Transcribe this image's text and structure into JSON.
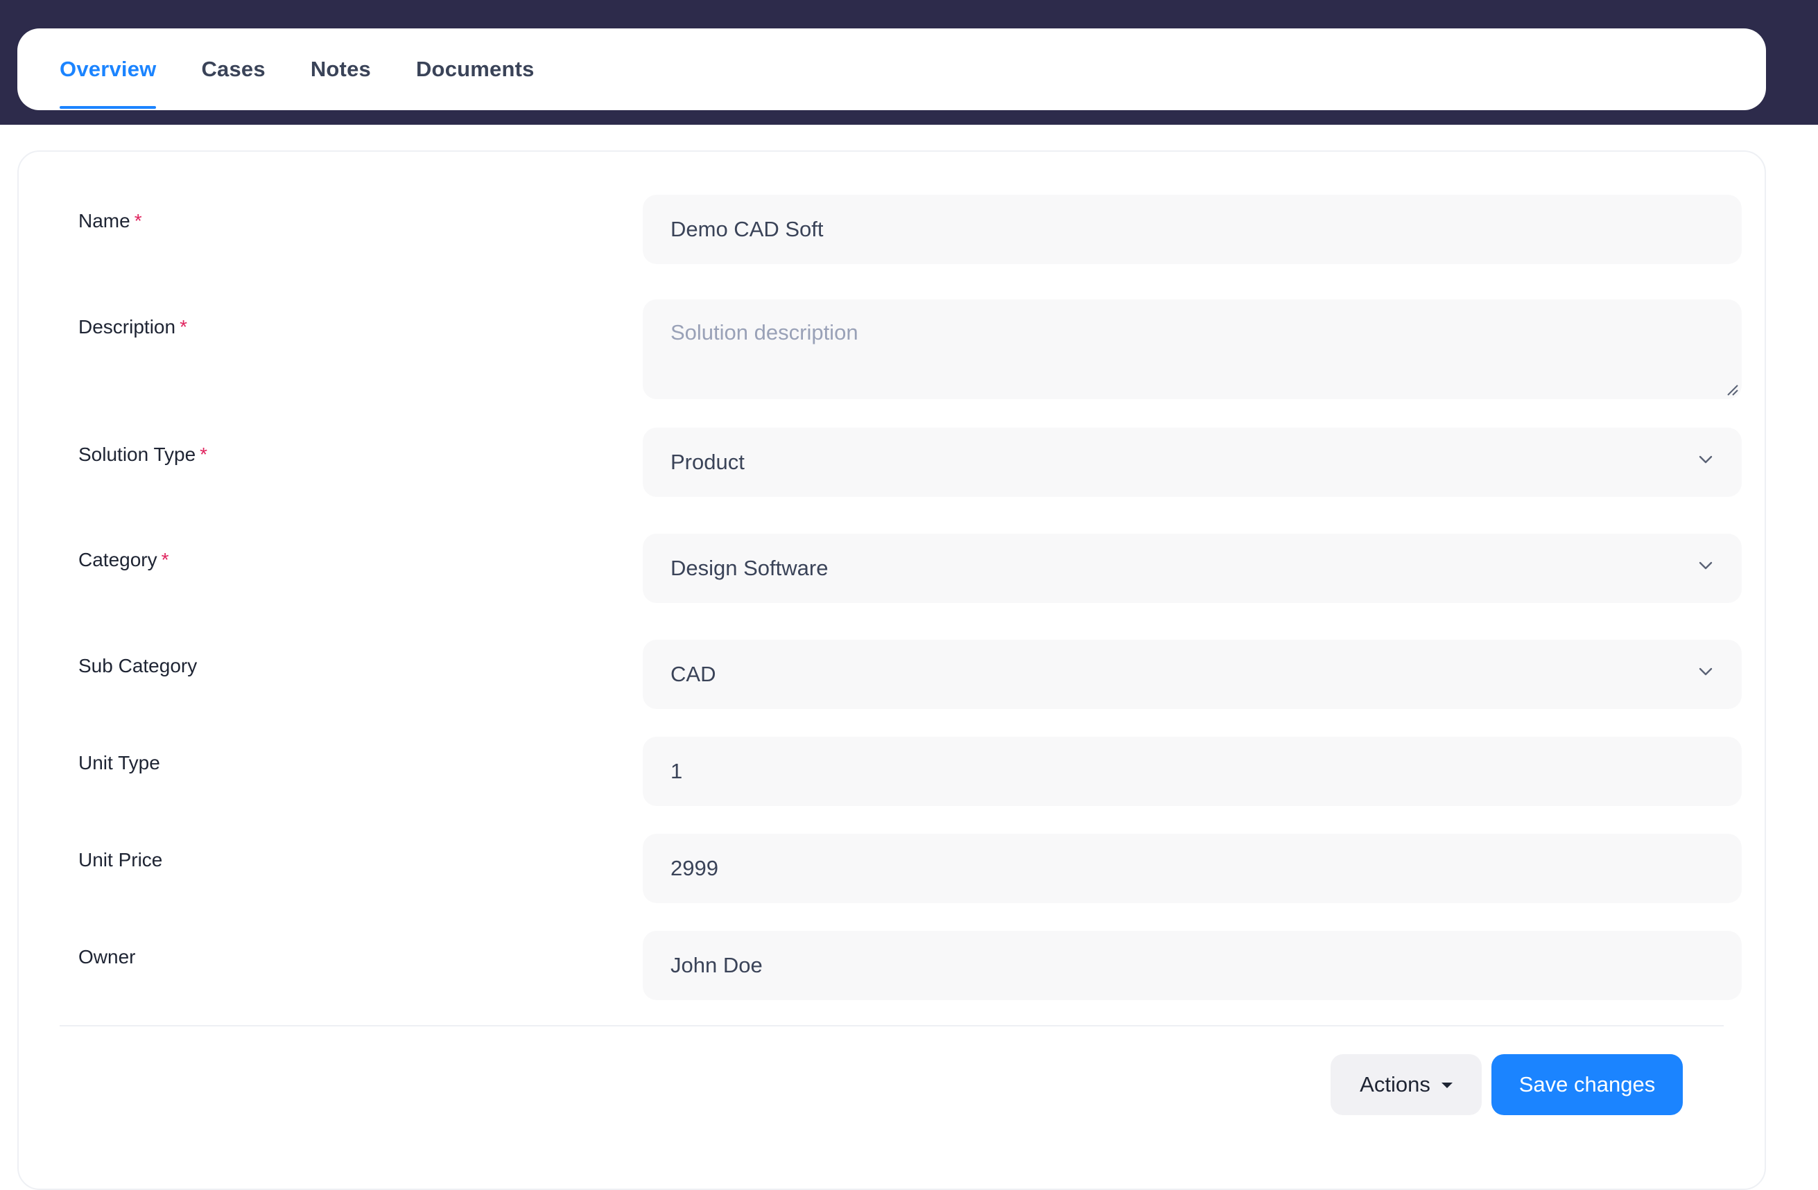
{
  "tabs": [
    {
      "label": "Overview",
      "active": true
    },
    {
      "label": "Cases",
      "active": false
    },
    {
      "label": "Notes",
      "active": false
    },
    {
      "label": "Documents",
      "active": false
    }
  ],
  "form": {
    "required_mark": "*",
    "name": {
      "label": "Name",
      "value": "Demo CAD Soft"
    },
    "description": {
      "label": "Description",
      "value": "",
      "placeholder": "Solution description"
    },
    "solution_type": {
      "label": "Solution Type",
      "value": "Product"
    },
    "category": {
      "label": "Category",
      "value": "Design Software"
    },
    "sub_category": {
      "label": "Sub Category",
      "value": "CAD"
    },
    "unit_type": {
      "label": "Unit Type",
      "value": "1"
    },
    "unit_price": {
      "label": "Unit Price",
      "value": "2999"
    },
    "owner": {
      "label": "Owner",
      "value": "John Doe"
    }
  },
  "footer": {
    "actions_label": "Actions",
    "save_label": "Save changes"
  },
  "colors": {
    "header_bg": "#2d2b4b",
    "accent": "#1b84ff",
    "required": "#e0245e"
  },
  "icons": {
    "select_arrow": "chevron-down-icon",
    "actions_caret": "caret-down-icon",
    "textarea_resize": "resize-grip-icon"
  }
}
